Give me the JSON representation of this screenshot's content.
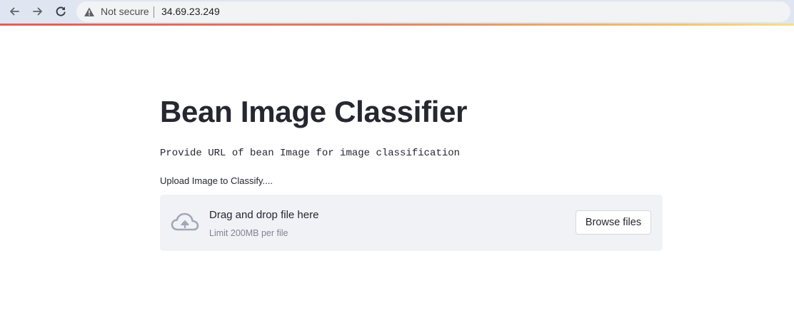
{
  "browser": {
    "security_label": "Not secure",
    "url": "34.69.23.249",
    "icons": {
      "back": "arrow-left-icon",
      "forward": "arrow-right-icon",
      "reload": "reload-icon",
      "security": "warning-triangle-icon"
    }
  },
  "app": {
    "title": "Bean Image Classifier",
    "description": "Provide URL of bean Image for image classification",
    "uploader": {
      "label": "Upload Image to Classify....",
      "drop_text": "Drag and drop file here",
      "limit_text": "Limit 200MB per file",
      "browse_label": "Browse files",
      "icon": "cloud-upload-icon"
    }
  },
  "colors": {
    "browser_toolbar": "#dfe6f2",
    "omnibox": "#f1f3f4",
    "text_primary": "#262730",
    "text_muted": "#808495",
    "dropzone_bg": "#f0f2f6",
    "cloud_icon": "#a3a8b8",
    "deco_line_start": "#e25c5c",
    "deco_line_end": "#f6e08a"
  }
}
